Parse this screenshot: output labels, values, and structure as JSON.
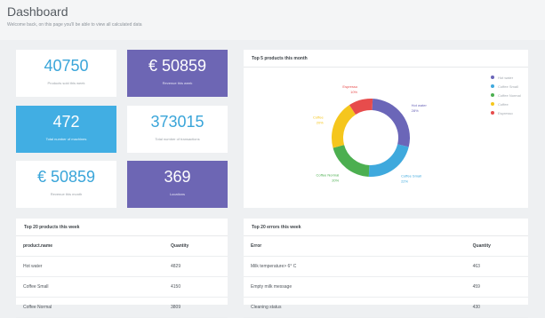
{
  "header": {
    "title": "Dashboard",
    "subtitle": "Welcome back, on this page you'll be able to view all calculated data"
  },
  "tiles": [
    {
      "value": "40750",
      "label": "Products sold this week"
    },
    {
      "value": "€ 50859",
      "label": "Revenue this week"
    },
    {
      "value": "472",
      "label": "Total number of machines"
    },
    {
      "value": "373015",
      "label": "Total number of transactions"
    },
    {
      "value": "€ 50859",
      "label": "Revenue this month"
    },
    {
      "value": "369",
      "label": "Locations"
    }
  ],
  "top5": {
    "title": "Top 5 products this month",
    "chart_data": {
      "type": "pie",
      "title": "Top 5 products this month",
      "categories": [
        "Hot water",
        "Coffee Small",
        "Coffee Normal",
        "Coffee",
        "Espresso"
      ],
      "values": [
        28,
        22,
        20,
        20,
        10
      ],
      "colors": [
        "#6b66b8",
        "#3fa9dd",
        "#4caf50",
        "#f5c61d",
        "#e74c4c"
      ],
      "data_labels": [
        {
          "name": "Hot water",
          "pct": "28%"
        },
        {
          "name": "Coffee Small",
          "pct": "22%"
        },
        {
          "name": "Coffee Normal",
          "pct": "20%"
        },
        {
          "name": "Coffee",
          "pct": "20%"
        },
        {
          "name": "Espresso",
          "pct": "10%"
        }
      ],
      "legend_position": "top-right"
    }
  },
  "top_products": {
    "title": "Top 20 products this week",
    "columns": [
      "product.name",
      "Quantity"
    ],
    "rows": [
      [
        "Hot water",
        "4829"
      ],
      [
        "Coffee Small",
        "4150"
      ],
      [
        "Coffee Normal",
        "3809"
      ]
    ]
  },
  "top_errors": {
    "title": "Top 20 errors this week",
    "columns": [
      "Error",
      "Quantity"
    ],
    "rows": [
      [
        "Milk temperature> 6° C",
        "463"
      ],
      [
        "Empty milk message",
        "459"
      ],
      [
        "Cleaning status",
        "430"
      ]
    ]
  }
}
